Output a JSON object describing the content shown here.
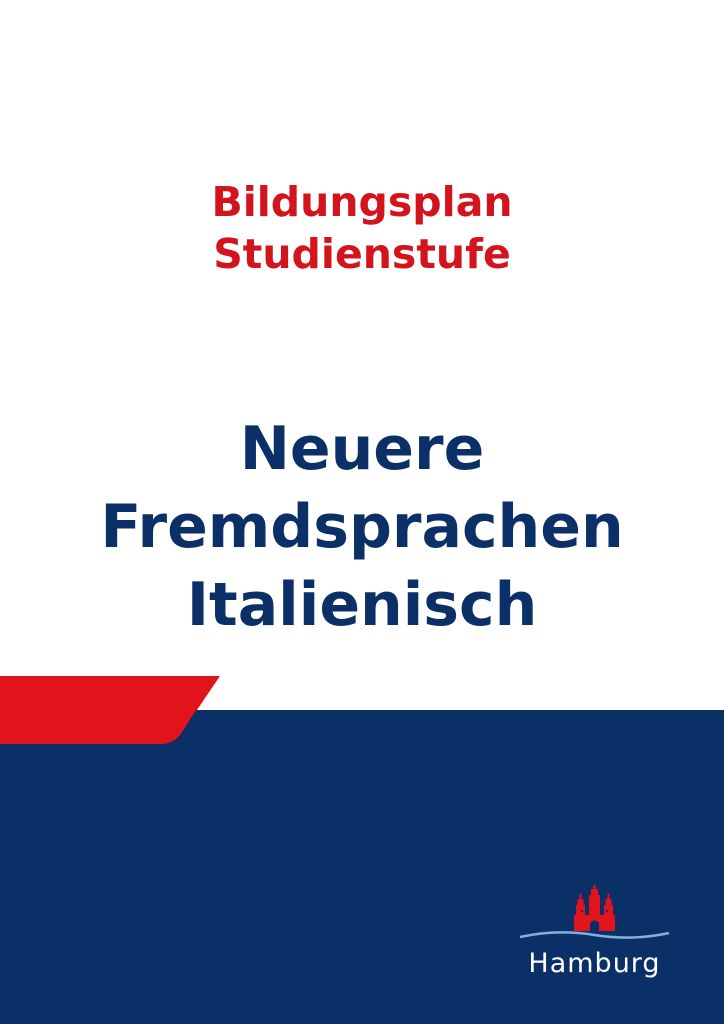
{
  "cover": {
    "subtitle_line1": "Bildungsplan",
    "subtitle_line2": "Studienstufe",
    "title_line1": "Neuere",
    "title_line2": "Fremdsprachen",
    "title_line3": "Italienisch"
  },
  "logo": {
    "text": "Hamburg",
    "icon": "hamburg-castle-coat-of-arms"
  },
  "colors": {
    "red": "#d4141c",
    "navy": "#0b3067",
    "wave": "#7fb2de",
    "background": "#ffffff"
  }
}
